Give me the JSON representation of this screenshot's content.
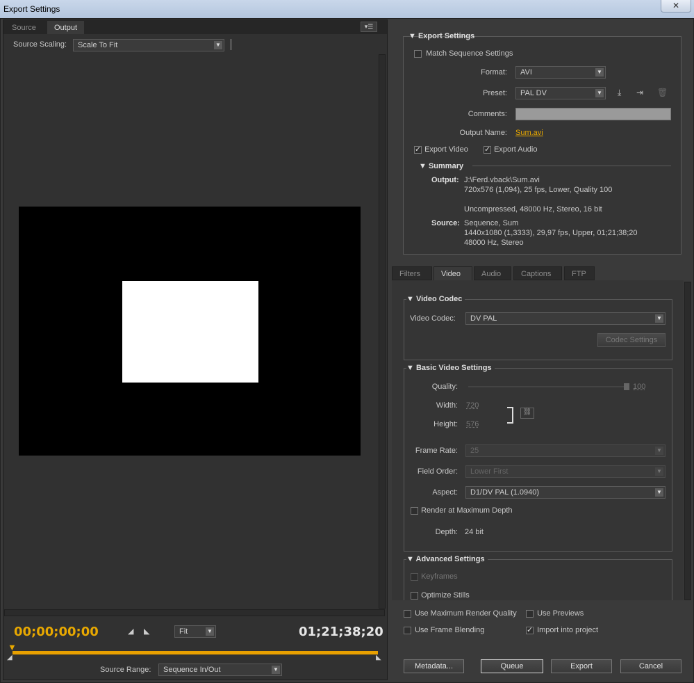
{
  "window": {
    "title": "Export Settings",
    "close": "✕"
  },
  "left": {
    "tabs": [
      "Source",
      "Output"
    ],
    "menu": "▾☰",
    "source_scaling_label": "Source Scaling:",
    "source_scaling_value": "Scale To Fit",
    "timecode_start": "00;00;00;00",
    "timecode_end": "01;21;38;20",
    "zoom_value": "Fit",
    "source_range_label": "Source Range:",
    "source_range_value": "Sequence In/Out"
  },
  "export": {
    "section_title": "Export Settings",
    "match_sequence": "Match Sequence Settings",
    "format_label": "Format:",
    "format_value": "AVI",
    "preset_label": "Preset:",
    "preset_value": "PAL DV",
    "comments_label": "Comments:",
    "output_name_label": "Output Name:",
    "output_name_value": "Sum.avi",
    "export_video": "Export Video",
    "export_audio": "Export Audio"
  },
  "summary": {
    "title": "Summary",
    "output_label": "Output:",
    "output_lines": [
      "J:\\Ferd.vback\\Sum.avi",
      "720x576 (1,094), 25 fps, Lower, Quality 100",
      "Uncompressed, 48000 Hz, Stereo, 16 bit"
    ],
    "source_label": "Source:",
    "source_lines": [
      "Sequence, Sum",
      "1440x1080 (1,3333), 29,97 fps, Upper, 01;21;38;20",
      "48000 Hz, Stereo"
    ]
  },
  "tabs": [
    "Filters",
    "Video",
    "Audio",
    "Captions",
    "FTP"
  ],
  "video_codec": {
    "title": "Video Codec",
    "label": "Video Codec:",
    "value": "DV PAL",
    "settings_button": "Codec Settings"
  },
  "basic_video": {
    "title": "Basic Video Settings",
    "quality_label": "Quality:",
    "quality_value": "100",
    "width_label": "Width:",
    "width_value": "720",
    "height_label": "Height:",
    "height_value": "576",
    "frame_rate_label": "Frame Rate:",
    "frame_rate_value": "25",
    "field_order_label": "Field Order:",
    "field_order_value": "Lower First",
    "aspect_label": "Aspect:",
    "aspect_value": "D1/DV PAL (1.0940)",
    "render_max_depth": "Render at Maximum Depth",
    "depth_label": "Depth:",
    "depth_value": "24 bit"
  },
  "advanced": {
    "title": "Advanced Settings",
    "keyframes": "Keyframes",
    "optimize_stills": "Optimize Stills"
  },
  "bottom": {
    "max_render_quality": "Use Maximum Render Quality",
    "use_previews": "Use Previews",
    "frame_blending": "Use Frame Blending",
    "import_into_project": "Import into project",
    "metadata_button": "Metadata...",
    "queue_button": "Queue",
    "export_button": "Export",
    "cancel_button": "Cancel"
  },
  "colors": {
    "accent": "#e8a800",
    "panel": "#353535",
    "background": "#2b2b2b"
  }
}
